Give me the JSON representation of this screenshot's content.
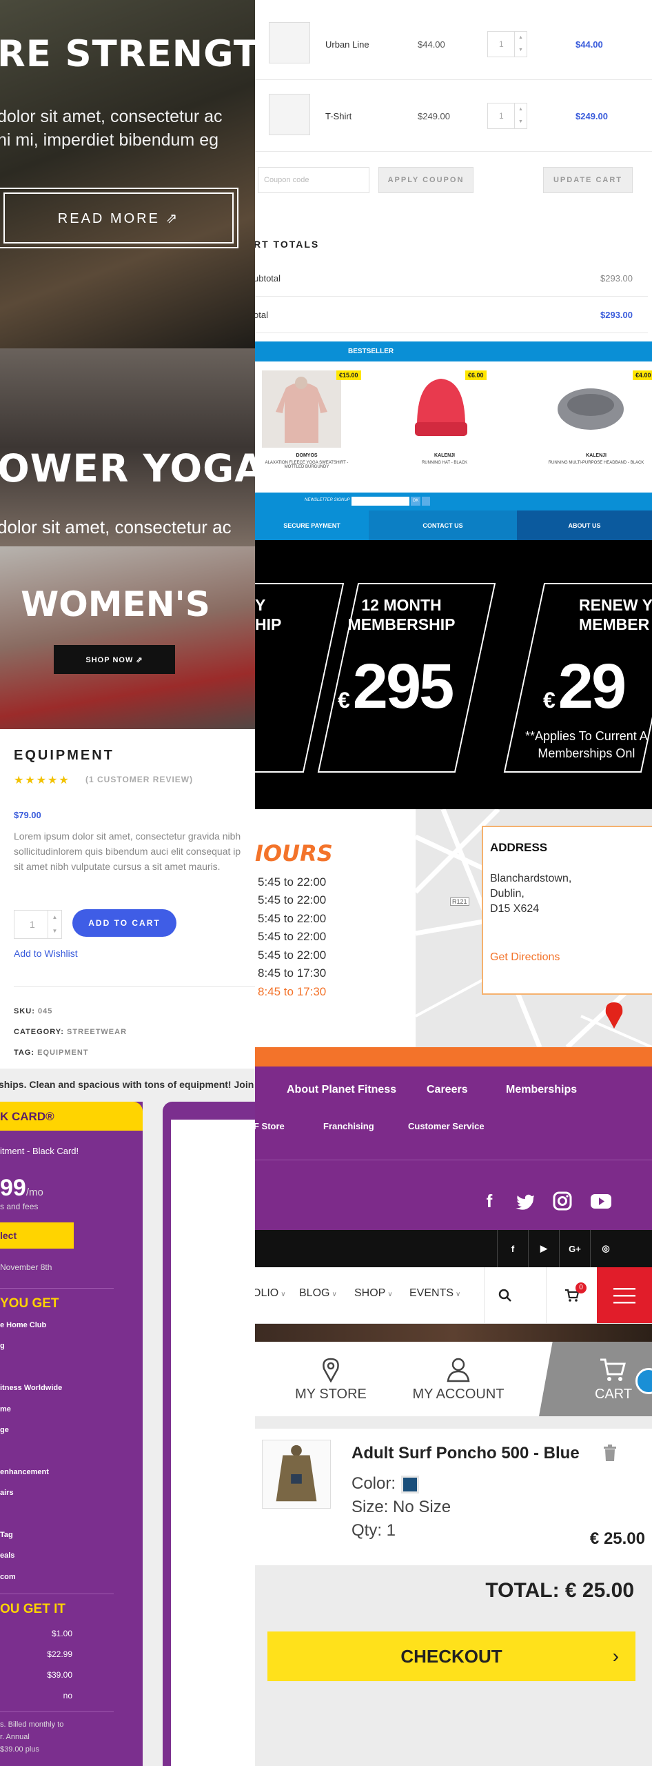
{
  "hero1": {
    "title": "RE STRENGT",
    "body_line1": "dolor sit amet, consectetur ac",
    "body_line2": "ni mi, imperdiet bibendum eg",
    "button": "READ MORE ⇗"
  },
  "hero2": {
    "title": "OWER YOGA",
    "body": "dolor sit amet, consectetur ac"
  },
  "hero3": {
    "title": "WOMEN'S",
    "button": "SHOP NOW ⇗"
  },
  "product": {
    "title": "EQUIPMENT",
    "stars": "★★★★★",
    "reviews": "(1 CUSTOMER REVIEW)",
    "price": "$79.00",
    "desc_lines": [
      "Lorem ipsum dolor sit amet, consectetur gravida nibh",
      "sollicitudinlorem quis bibendum auci elit consequat ip",
      "sit amet nibh vulputate cursus a sit amet mauris."
    ],
    "qty": "1",
    "add_to_cart": "ADD TO CART",
    "wishlist": "Add to Wishlist",
    "sku_label": "SKU:",
    "sku": "045",
    "category_label": "CATEGORY:",
    "category": "STREETWEAR",
    "tag_label": "TAG:",
    "tag": "EQUIPMENT"
  },
  "membership_left": {
    "tagline": "ships. Clean and spacious with tons of equipment! Join now!",
    "card_title": "K CARD®",
    "subtitle": "itment - Black Card!",
    "price": "99",
    "per": "/mo",
    "fees": "s and fees",
    "select": "lect",
    "date": "November 8th",
    "what_you_get": "YOU GET",
    "features": [
      "e Home Club",
      "g",
      "itness Worldwide",
      "me",
      "ge",
      "enhancement",
      "airs",
      "Tag",
      "eals",
      "com"
    ],
    "how_you_get": "OU GET IT",
    "fee_rows": [
      {
        "v": "$1.00"
      },
      {
        "v": "$22.99"
      },
      {
        "v": "$39.00"
      },
      {
        "v": "no"
      }
    ],
    "footer_lines": [
      "s. Billed monthly to",
      "r. Annual",
      "$39.00 plus"
    ]
  },
  "cart": {
    "rows": [
      {
        "name": "Urban Line",
        "price": "$44.00",
        "qty": "1",
        "total": "$44.00"
      },
      {
        "name": "T-Shirt",
        "price": "$249.00",
        "qty": "1",
        "total": "$249.00"
      }
    ],
    "coupon_placeholder": "Coupon code",
    "apply_coupon": "APPLY COUPON",
    "update_cart": "UPDATE CART",
    "cart_totals": "RT TOTALS",
    "subtotal_label": "ubtotal",
    "subtotal": "$293.00",
    "total_label": "otal",
    "total": "$293.00"
  },
  "bestseller": {
    "title": "BESTSELLER",
    "items": [
      {
        "badge": "€15.00",
        "brand": "DOMYOS",
        "desc": "ALAXATION FLEECE YOGA SWEATSHIRT - MOTTLED BURGUNDY"
      },
      {
        "badge": "€6.00",
        "brand": "KALENJI",
        "desc": "RUNNING HAT - BLACK"
      },
      {
        "badge": "€4.00",
        "brand": "KALENJI",
        "desc": "RUNNING MULTI-PURPOSE HEADBAND - BLACK"
      }
    ],
    "newsletter_label": "NEWSLETTER SIGNUP",
    "ok": "OK",
    "nav": [
      "SECURE PAYMENT",
      "CONTACT US",
      "ABOUT US"
    ]
  },
  "membership_banner": {
    "left_t1": "Y",
    "left_t2": "HIP",
    "mid_t1": "12 MONTH",
    "mid_t2": "MEMBERSHIP",
    "mid_currency": "€",
    "mid_price": "295",
    "right_t1": "RENEW Y",
    "right_t2": "MEMBER",
    "right_currency": "€",
    "right_price": "29",
    "note1": "**Applies To Current A",
    "note2": "Memberships Onl"
  },
  "hours": {
    "title": "IOURS",
    "rows": [
      "5:45 to 22:00",
      "5:45 to 22:00",
      "5:45 to 22:00",
      "5:45 to 22:00",
      "5:45 to 22:00",
      "8:45 to 17:30",
      "8:45 to 17:30"
    ],
    "address_title": "ADDRESS",
    "address_lines": [
      "Blanchardstown,",
      "Dublin,",
      "D15 X624"
    ],
    "directions": "Get Directions",
    "map_label": "R121"
  },
  "pf_footer": {
    "links_row1": [
      "About Planet Fitness",
      "Careers",
      "Memberships"
    ],
    "links_row2": [
      "F Store",
      "Franchising",
      "Customer Service"
    ]
  },
  "darkbar": {
    "icons": [
      "f",
      "▶",
      "G+",
      "◎"
    ]
  },
  "blognav": {
    "items": [
      "OLIO",
      "BLOG",
      "SHOP",
      "EVENTS"
    ],
    "cart_count": "0"
  },
  "mobile_cart": {
    "tabs": [
      "MY STORE",
      "MY ACCOUNT",
      "CART"
    ],
    "product_name": "Adult Surf Poncho 500 - Blue",
    "color_label": "Color:",
    "size": "Size: No Size",
    "qty": "Qty: 1",
    "price": "€ 25.00",
    "total": "TOTAL: € 25.00",
    "checkout": "CHECKOUT",
    "checkout_arrow": "›"
  },
  "colors": {
    "accent_blue": "#3f5de6",
    "pf_purple": "#7d2b8a",
    "pf_orange": "#f3732a",
    "yellow": "#ffe11b",
    "decathlon_blue": "#0a8fd6",
    "red": "#e11d2a"
  }
}
